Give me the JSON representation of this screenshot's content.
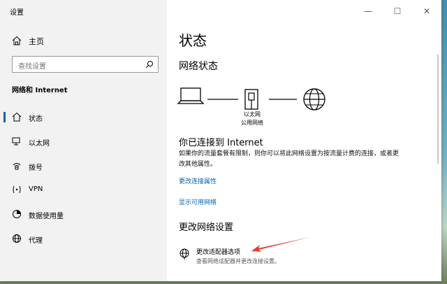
{
  "window": {
    "title": "设置",
    "minimize": "—",
    "maximize": "☐",
    "close": "✕"
  },
  "sidebar": {
    "home_label": "主页",
    "search_placeholder": "查找设置",
    "section_title": "网络和 Internet",
    "items": [
      {
        "label": "状态",
        "icon": "home-status-icon",
        "active": true
      },
      {
        "label": "以太网",
        "icon": "ethernet-icon",
        "active": false
      },
      {
        "label": "拨号",
        "icon": "dialup-icon",
        "active": false
      },
      {
        "label": "VPN",
        "icon": "vpn-icon",
        "active": false
      },
      {
        "label": "数据使用量",
        "icon": "data-usage-icon",
        "active": false
      },
      {
        "label": "代理",
        "icon": "proxy-icon",
        "active": false
      }
    ]
  },
  "main": {
    "page_title": "状态",
    "network_status_heading": "网络状态",
    "adapter_name": "以太网",
    "network_type": "公用网络",
    "connected_text": "你已连接到 Internet",
    "description": "如果你的流量套餐有限制，则你可以将此网络设置为按流量计费的连接，或者更改其他属性。",
    "link_change_properties": "更改连接属性",
    "link_show_networks": "显示可用网络",
    "change_settings_heading": "更改网络设置",
    "adapter_option_title": "更改适配器选项",
    "adapter_option_desc": "查看网络适配器并更改连接设置。"
  },
  "colors": {
    "accent": "#0063b1",
    "annotation_arrow": "#e53935"
  }
}
